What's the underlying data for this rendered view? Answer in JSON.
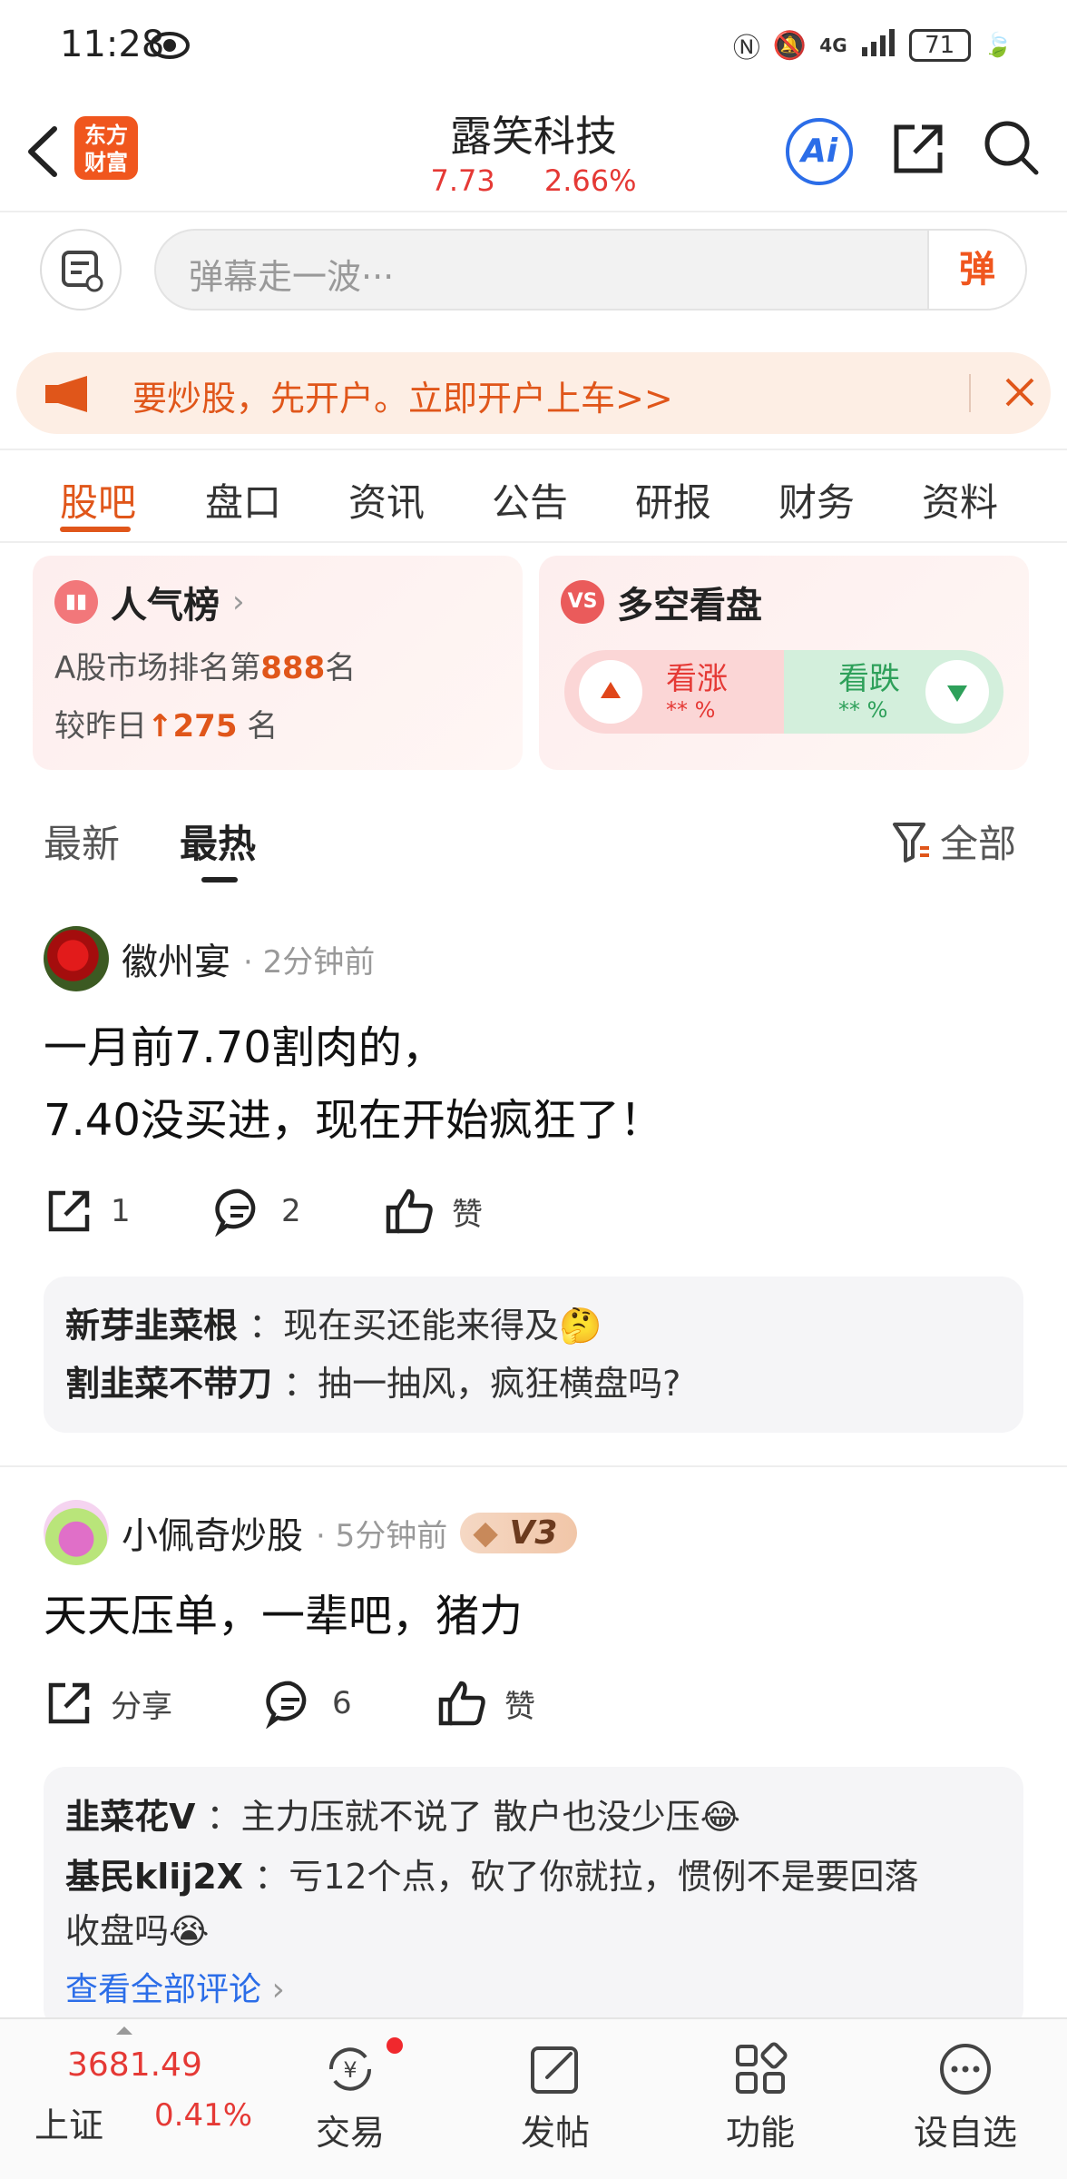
{
  "status_bar": {
    "time": "11:28",
    "battery": "71",
    "network": "4G"
  },
  "header": {
    "stock_name": "露笑科技",
    "price": "7.73",
    "change_pct": "2.66%",
    "logo_text": "东方\n财富",
    "ai_label": "Ai"
  },
  "danmu": {
    "placeholder": "弹幕走一波···",
    "button_label": "弹"
  },
  "ad_banner": {
    "text": "要炒股，先开户。立即开户上车>>"
  },
  "tabs": [
    "股吧",
    "盘口",
    "资讯",
    "公告",
    "研报",
    "财务",
    "资料"
  ],
  "popularity_card": {
    "title": "人气榜",
    "rank_prefix": "A股市场排名第",
    "rank": "888",
    "rank_suffix": "名",
    "change_prefix": "较昨日",
    "change": "275",
    "change_suffix": "名"
  },
  "sentiment_card": {
    "title": "多空看盘",
    "up_label": "看涨",
    "up_value": "** %",
    "down_label": "看跌",
    "down_value": "** %"
  },
  "feed_filter": {
    "latest": "最新",
    "hottest": "最热",
    "all": "全部"
  },
  "posts": [
    {
      "user": "徽州宴",
      "time": "· 2分钟前",
      "lines": [
        "一月前7.70割肉的，",
        "7.40没买进，现在开始疯狂了！"
      ],
      "share": "1",
      "comments_count": "2",
      "like": "赞",
      "comments": [
        {
          "user": "新芽韭菜根",
          "text": "：现在买还能来得及🤔"
        },
        {
          "user": "割韭菜不带刀",
          "text": "：抽一抽风，疯狂横盘吗?"
        }
      ]
    },
    {
      "user": "小佩奇炒股",
      "time": "· 5分钟前",
      "level": "V3",
      "lines": [
        "天天压单，一辈吧，猪力"
      ],
      "share": "分享",
      "comments_count": "6",
      "like": "赞",
      "comments": [
        {
          "user": "韭菜花V",
          "text": "：主力压就不说了 散户也没少压😂"
        },
        {
          "user": "基民klij2X",
          "text": "：亏12个点，砍了你就拉，惯例不是要回落"
        },
        {
          "user": "",
          "text": "收盘吗😭"
        }
      ],
      "view_all": "查看全部评论"
    }
  ],
  "bottom_bar": {
    "index_value": "3681.49",
    "index_name": "上证",
    "index_pct": "0.41%",
    "items": [
      "交易",
      "发帖",
      "功能",
      "设自选"
    ]
  },
  "colors": {
    "brand": "#e0561a",
    "up": "#e53935",
    "down": "#2ea05a",
    "link": "#2b6de8"
  }
}
